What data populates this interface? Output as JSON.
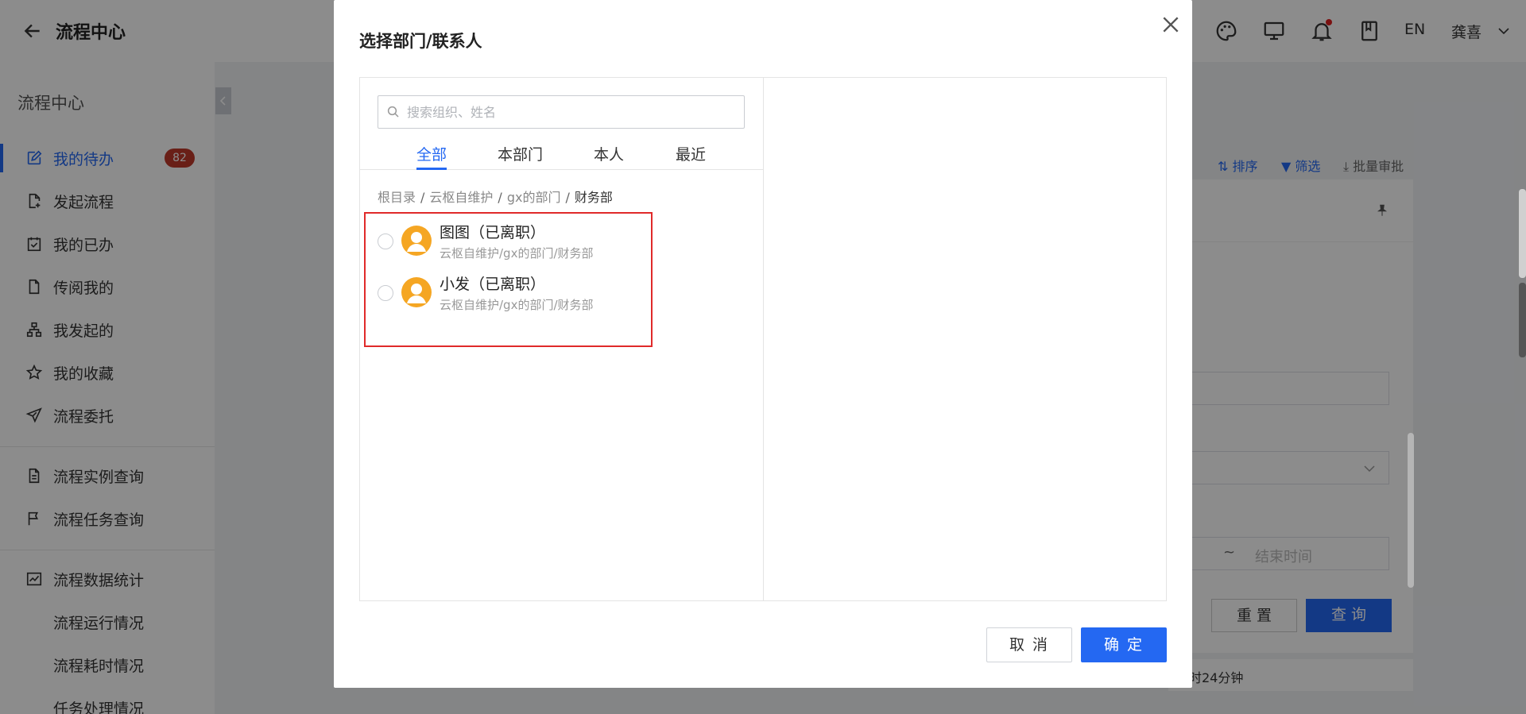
{
  "header": {
    "title": "流程中心",
    "lang": "EN",
    "user": "龚喜"
  },
  "sidebar": {
    "title": "流程中心",
    "items": [
      {
        "label": "我的待办",
        "badge": "82"
      },
      {
        "label": "发起流程"
      },
      {
        "label": "我的已办"
      },
      {
        "label": "传阅我的"
      },
      {
        "label": "我发起的"
      },
      {
        "label": "我的收藏"
      },
      {
        "label": "流程委托"
      },
      {
        "label": "流程实例查询"
      },
      {
        "label": "流程任务查询"
      },
      {
        "label": "流程数据统计"
      },
      {
        "label": "流程运行情况"
      },
      {
        "label": "流程耗时情况"
      },
      {
        "label": "任务处理情况"
      }
    ]
  },
  "background": {
    "sort": "排序",
    "filter": "筛选",
    "batch": "批量审批",
    "date_sep": "~",
    "end_time": "结束时间",
    "reset": "重 置",
    "query": "查 询",
    "duration": "时24分钟"
  },
  "modal": {
    "title": "选择部门/联系人",
    "search_placeholder": "搜索组织、姓名",
    "tabs": [
      "全部",
      "本部门",
      "本人",
      "最近"
    ],
    "breadcrumb": [
      "根目录",
      "云枢自维护",
      "gx的部门",
      "财务部"
    ],
    "people": [
      {
        "name": "图图（已离职）",
        "path": "云枢自维护/gx的部门/财务部"
      },
      {
        "name": "小发（已离职）",
        "path": "云枢自维护/gx的部门/财务部"
      }
    ],
    "cancel": "取 消",
    "confirm": "确 定"
  },
  "colors": {
    "primary": "#2468f2",
    "badge": "#c0392b",
    "avatar": "#f5a623",
    "highlight": "#e02a2a"
  }
}
